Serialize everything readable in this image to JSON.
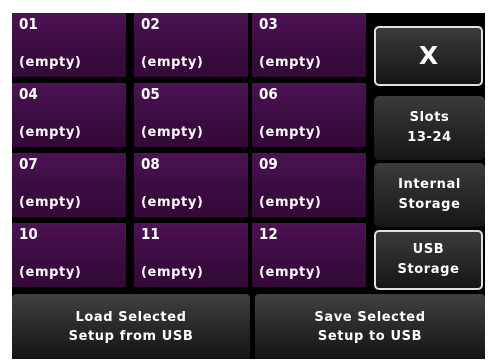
{
  "slots": [
    {
      "number": "01",
      "status": "(empty)"
    },
    {
      "number": "02",
      "status": "(empty)"
    },
    {
      "number": "03",
      "status": "(empty)"
    },
    {
      "number": "04",
      "status": "(empty)"
    },
    {
      "number": "05",
      "status": "(empty)"
    },
    {
      "number": "06",
      "status": "(empty)"
    },
    {
      "number": "07",
      "status": "(empty)"
    },
    {
      "number": "08",
      "status": "(empty)"
    },
    {
      "number": "09",
      "status": "(empty)"
    },
    {
      "number": "10",
      "status": "(empty)"
    },
    {
      "number": "11",
      "status": "(empty)"
    },
    {
      "number": "12",
      "status": "(empty)"
    }
  ],
  "sidebar": {
    "close_label": "X",
    "slots_label": "Slots\n13-24",
    "internal_label": "Internal\nStorage",
    "usb_label": "USB\nStorage"
  },
  "footer": {
    "load_label": "Load Selected\nSetup from USB",
    "save_label": "Save Selected\nSetup to USB"
  },
  "colors": {
    "slot_bg": "#3e0c44",
    "button_bg": "#2a2a2a",
    "screen_bg": "#000000",
    "outline": "#e0e0e0"
  }
}
